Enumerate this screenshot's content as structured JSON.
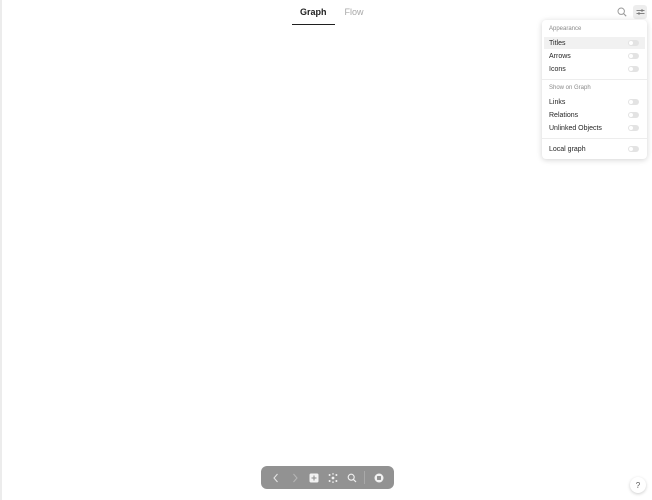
{
  "tabs": [
    {
      "label": "Graph",
      "active": true
    },
    {
      "label": "Flow",
      "active": false
    }
  ],
  "icons": {
    "search": "search-icon",
    "settings": "settings-sliders-icon"
  },
  "panel": {
    "appearance_title": "Appearance",
    "appearance_items": [
      {
        "label": "Titles",
        "enabled": false
      },
      {
        "label": "Arrows",
        "enabled": false
      },
      {
        "label": "Icons",
        "enabled": false
      }
    ],
    "show_title": "Show on Graph",
    "show_items": [
      {
        "label": "Links",
        "enabled": false
      },
      {
        "label": "Relations",
        "enabled": false
      },
      {
        "label": "Unlinked Objects",
        "enabled": false
      }
    ],
    "local_graph": {
      "label": "Local graph",
      "enabled": false
    }
  },
  "toolbar": {
    "buttons": [
      "chevron-left-icon",
      "chevron-right-icon",
      "plus-icon",
      "graph-icon",
      "search-icon",
      "gallery-icon"
    ]
  },
  "help": {
    "label": "?"
  },
  "colors": {
    "toolbar_bg": "#929292",
    "toggle_off": "#e3e3e3",
    "active_tab": "#1f1f1f",
    "inactive_tab": "#a8a8a8"
  }
}
